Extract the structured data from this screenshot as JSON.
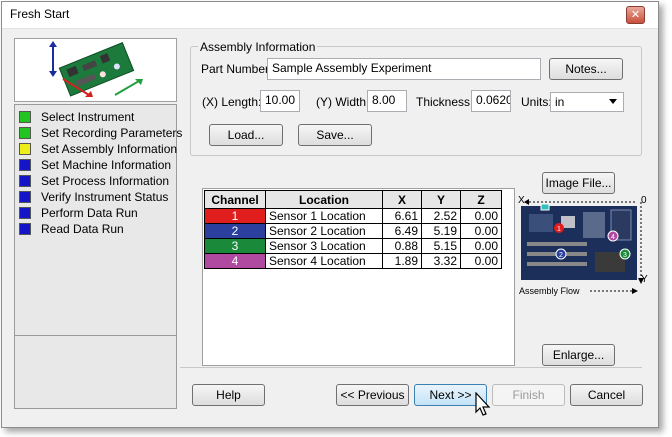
{
  "window": {
    "title": "Fresh Start"
  },
  "steps": [
    {
      "label": "Select Instrument",
      "color": "#22c422"
    },
    {
      "label": "Set Recording Parameters",
      "color": "#22c422"
    },
    {
      "label": "Set Assembly Information",
      "color": "#eded1a"
    },
    {
      "label": "Set Machine Information",
      "color": "#1414c8"
    },
    {
      "label": "Set Process Information",
      "color": "#1414c8"
    },
    {
      "label": "Verify Instrument Status",
      "color": "#1414c8"
    },
    {
      "label": "Perform Data Run",
      "color": "#1414c8"
    },
    {
      "label": "Read Data Run",
      "color": "#1414c8"
    }
  ],
  "assembly": {
    "group_label": "Assembly Information",
    "part_number_label": "Part Number:",
    "part_number": "Sample Assembly Experiment",
    "notes_btn": "Notes...",
    "length_label": "(X) Length:",
    "length": "10.00",
    "width_label": "(Y) Width:",
    "width": "8.00",
    "thickness_label": "Thickness:",
    "thickness": "0.0620",
    "units_label": "Units:",
    "units": "in",
    "load_btn": "Load...",
    "save_btn": "Save..."
  },
  "table": {
    "headers": [
      "Channel",
      "Location",
      "X",
      "Y",
      "Z"
    ],
    "rows": [
      {
        "channel": "1",
        "color": "#e01e1e",
        "location": "Sensor 1 Location",
        "x": "6.61",
        "y": "2.52",
        "z": "0.00"
      },
      {
        "channel": "2",
        "color": "#2a3f9e",
        "location": "Sensor 2 Location",
        "x": "6.49",
        "y": "5.19",
        "z": "0.00"
      },
      {
        "channel": "3",
        "color": "#1a8a3a",
        "location": "Sensor 3 Location",
        "x": "0.88",
        "y": "5.15",
        "z": "0.00"
      },
      {
        "channel": "4",
        "color": "#b04aa0",
        "location": "Sensor 4 Location",
        "x": "1.89",
        "y": "3.32",
        "z": "0.00"
      }
    ]
  },
  "image": {
    "image_file_btn": "Image File...",
    "enlarge_btn": "Enlarge...",
    "x_axis": "X",
    "y_axis": "Y",
    "origin": "0",
    "flow_label": "Assembly Flow",
    "markers": [
      "1",
      "2",
      "3",
      "4"
    ]
  },
  "buttons": {
    "help": "Help",
    "previous": "<< Previous",
    "next": "Next >>",
    "finish": "Finish",
    "cancel": "Cancel"
  }
}
